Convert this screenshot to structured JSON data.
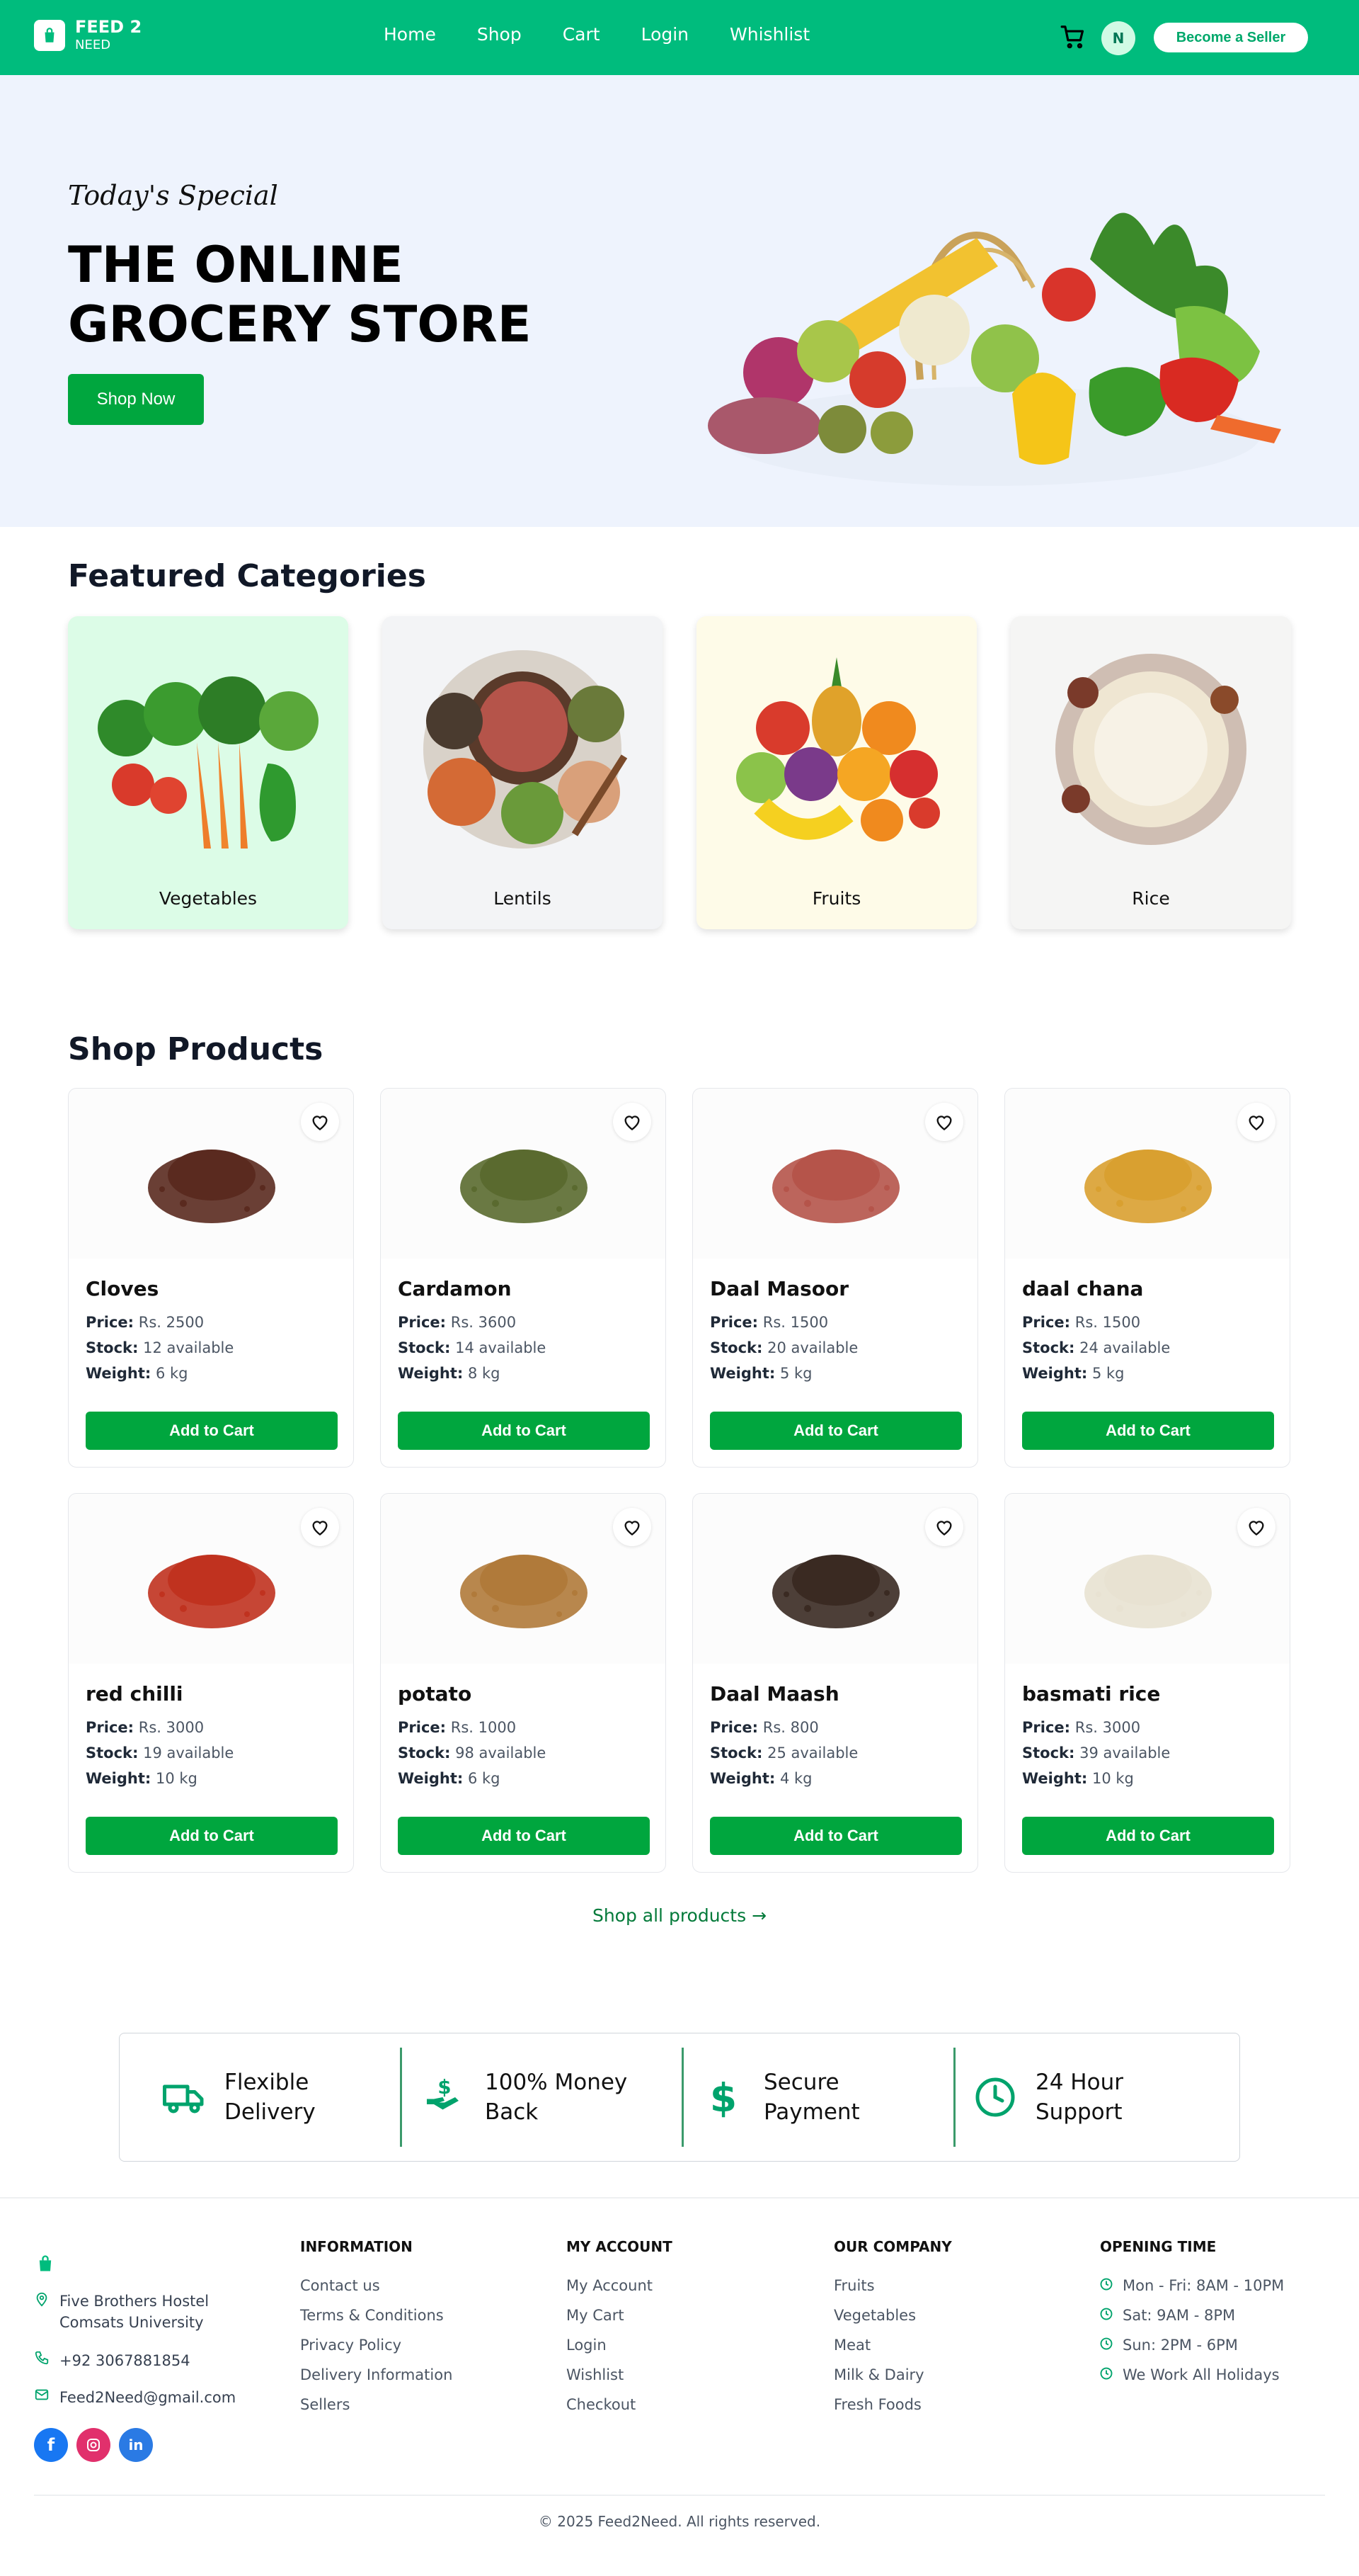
{
  "brand": {
    "line1": "FEED 2",
    "line2": "NEED"
  },
  "nav": [
    "Home",
    "Shop",
    "Cart",
    "Login",
    "Whishlist"
  ],
  "header": {
    "avatar_initial": "N",
    "seller_button": "Become a Seller"
  },
  "hero": {
    "special": "Today's Special",
    "title_line1": "THE ONLINE",
    "title_line2": "GROCERY STORE",
    "cta": "Shop Now"
  },
  "categories": {
    "title": "Featured Categories",
    "items": [
      {
        "label": "Vegetables",
        "bg": "#dcfce7"
      },
      {
        "label": "Lentils",
        "bg": "#f3f4f6"
      },
      {
        "label": "Fruits",
        "bg": "#fefbe8"
      },
      {
        "label": "Rice",
        "bg": "#f5f5f4"
      }
    ]
  },
  "products": {
    "title": "Shop Products",
    "price_label": "Price:",
    "stock_label": "Stock:",
    "weight_label": "Weight:",
    "button": "Add to Cart",
    "items": [
      {
        "name": "Cloves",
        "price": "Rs. 2500",
        "stock": "12 available",
        "weight": "6 kg",
        "img": "cloves-image"
      },
      {
        "name": "Cardamon",
        "price": "Rs. 3600",
        "stock": "14 available",
        "weight": "8 kg",
        "img": "cardamom-image"
      },
      {
        "name": "Daal Masoor",
        "price": "Rs. 1500",
        "stock": "20 available",
        "weight": "5 kg",
        "img": "daal-masoor-image"
      },
      {
        "name": "daal chana",
        "price": "Rs. 1500",
        "stock": "24 available",
        "weight": "5 kg",
        "img": "daal-chana-image"
      },
      {
        "name": "red chilli",
        "price": "Rs. 3000",
        "stock": "19 available",
        "weight": "10 kg",
        "img": "red-chilli-image"
      },
      {
        "name": "potato",
        "price": "Rs. 1000",
        "stock": "98 available",
        "weight": "6 kg",
        "img": "potato-image"
      },
      {
        "name": "Daal Maash",
        "price": "Rs. 800",
        "stock": "25 available",
        "weight": "4 kg",
        "img": "daal-maash-image"
      },
      {
        "name": "basmati rice",
        "price": "Rs. 3000",
        "stock": "39 available",
        "weight": "10 kg",
        "img": "basmati-rice-image"
      }
    ],
    "shop_all": "Shop all products →"
  },
  "features": [
    {
      "line1": "Flexible",
      "line2": "Delivery",
      "icon": "truck-icon"
    },
    {
      "line1": "100% Money",
      "line2": "Back",
      "icon": "money-hand-icon"
    },
    {
      "line1": "Secure",
      "line2": "Payment",
      "icon": "dollar-icon"
    },
    {
      "line1": "24 Hour",
      "line2": "Support",
      "icon": "clock-icon"
    }
  ],
  "footer": {
    "address_line1": "Five Brothers Hostel",
    "address_line2": "Comsats University",
    "phone": "+92 3067881854",
    "email": "Feed2Need@gmail.com",
    "information": {
      "title": "INFORMATION",
      "links": [
        "Contact us",
        "Terms & Conditions",
        "Privacy Policy",
        "Delivery Information",
        "Sellers"
      ]
    },
    "my_account": {
      "title": "MY ACCOUNT",
      "links": [
        "My Account",
        "My Cart",
        "Login",
        "Wishlist",
        "Checkout"
      ]
    },
    "our_company": {
      "title": "OUR COMPANY",
      "links": [
        "Fruits",
        "Vegetables",
        "Meat",
        "Milk & Dairy",
        "Fresh Foods"
      ]
    },
    "opening_time": {
      "title": "OPENING TIME",
      "items": [
        "Mon - Fri: 8AM - 10PM",
        "Sat: 9AM - 8PM",
        "Sun: 2PM - 6PM",
        "We Work All Holidays"
      ]
    },
    "copyright": "© 2025 Feed2Need. All rights reserved."
  },
  "colors": {
    "primary": "#00bc7d",
    "button": "#00a63e",
    "hero_bg": "#eef3fd"
  }
}
